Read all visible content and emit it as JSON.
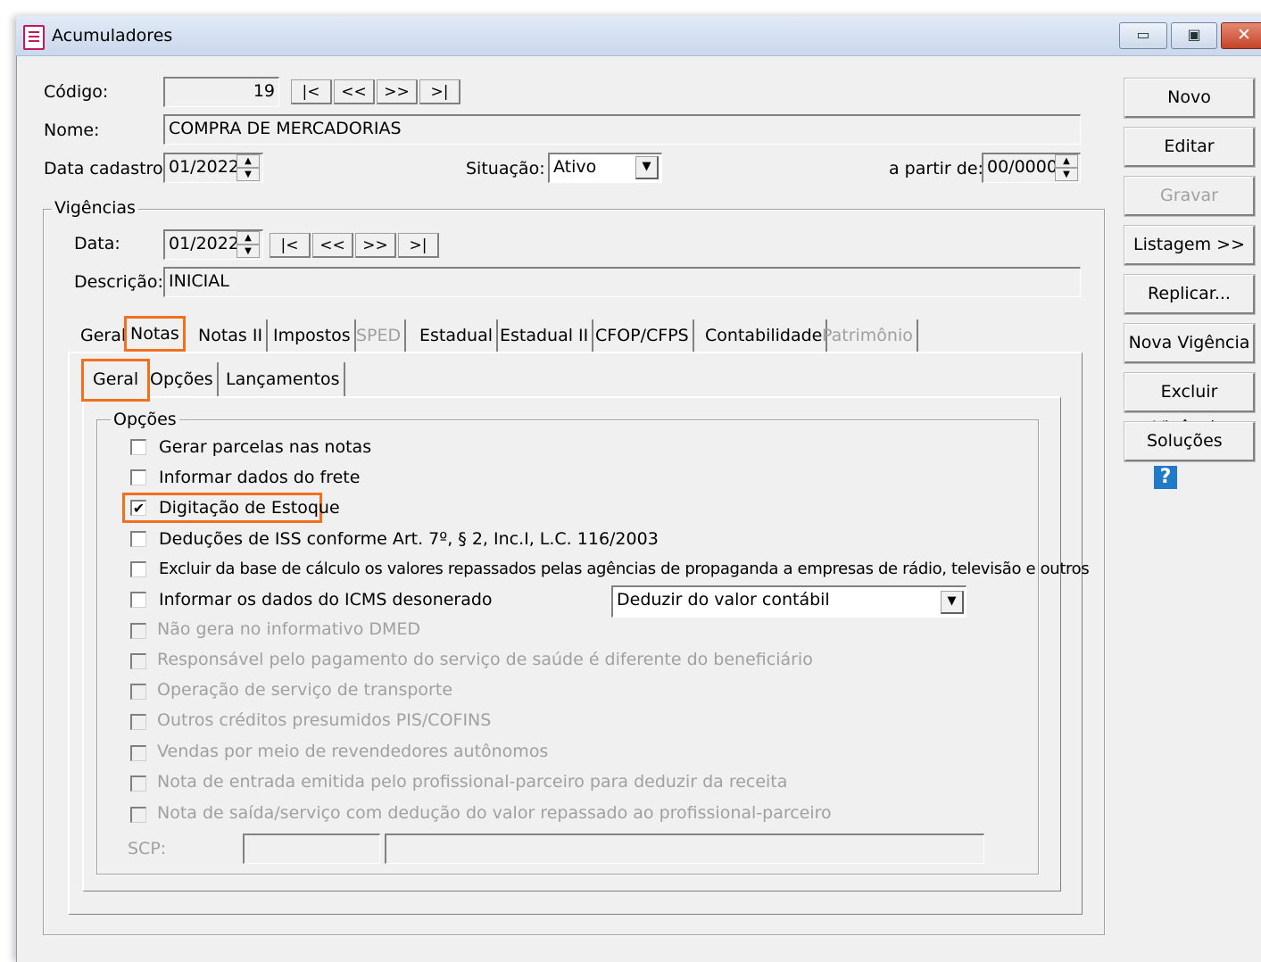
{
  "window": {
    "title": "Acumuladores",
    "minimize": "▭",
    "maximize": "▣",
    "close": "✕"
  },
  "form": {
    "codigo_label": "Código:",
    "codigo_value": "19",
    "nome_label": "Nome:",
    "nome_value": "COMPRA DE MERCADORIAS",
    "data_cadastro_label": "Data cadastro:",
    "data_cadastro_value": "01/2022",
    "situacao_label": "Situação:",
    "situacao_value": "Ativo",
    "a_partir_label": "a partir de:",
    "a_partir_value": "00/0000",
    "nav": [
      "|<",
      "<<",
      ">>",
      ">|"
    ]
  },
  "vigencias": {
    "group_label": "Vigências",
    "data_label": "Data:",
    "data_value": "01/2022",
    "descricao_label": "Descrição:",
    "descricao_value": "INICIAL"
  },
  "tabs": [
    "Geral",
    "Notas",
    "Notas II",
    "Impostos",
    "SPED",
    "Estadual",
    "Estadual II",
    "CFOP/CFPS",
    "Contabilidade",
    "Patrimônio"
  ],
  "subtabs": [
    "Geral",
    "Opções",
    "Lançamentos"
  ],
  "options": {
    "group_label": "Opções",
    "items": [
      {
        "label": "Gerar parcelas nas notas",
        "checked": false,
        "enabled": true
      },
      {
        "label": "Informar dados do frete",
        "checked": false,
        "enabled": true
      },
      {
        "label": "Digitação de Estoque",
        "checked": true,
        "enabled": true
      },
      {
        "label": "Deduções de ISS conforme Art. 7º, § 2, Inc.I, L.C. 116/2003",
        "checked": false,
        "enabled": true
      },
      {
        "label": "Excluir da base de cálculo os valores repassados pelas agências de propaganda a empresas de rádio, televisão e outros",
        "checked": false,
        "enabled": true
      },
      {
        "label": "Informar os dados do ICMS desonerado",
        "checked": false,
        "enabled": true
      },
      {
        "label": "Não gera no informativo DMED",
        "checked": false,
        "enabled": false
      },
      {
        "label": "Responsável pelo pagamento do serviço de saúde é diferente do beneficiário",
        "checked": false,
        "enabled": false
      },
      {
        "label": "Operação de serviço de transporte",
        "checked": false,
        "enabled": false
      },
      {
        "label": "Outros créditos presumidos PIS/COFINS",
        "checked": false,
        "enabled": false
      },
      {
        "label": "Vendas por meio de revendedores autônomos",
        "checked": false,
        "enabled": false
      },
      {
        "label": "Nota de entrada emitida pelo profissional-parceiro para deduzir da receita",
        "checked": false,
        "enabled": false
      },
      {
        "label": "Nota de saída/serviço com dedução do valor repassado ao profissional-parceiro",
        "checked": false,
        "enabled": false
      }
    ],
    "icms_select_value": "Deduzir do valor contábil",
    "scp_label": "SCP:"
  },
  "sidebar": {
    "buttons": [
      "Novo",
      "Editar",
      "Gravar",
      "Listagem >>",
      "Replicar...",
      "Nova Vigência",
      "Excluir Vigência",
      "Soluções"
    ],
    "help_glyph": "?"
  },
  "icons": {
    "app": "document-icon",
    "help": "help-icon",
    "check": "✔",
    "dropdown": "▼",
    "spin_up": "▲",
    "spin_down": "▼"
  }
}
